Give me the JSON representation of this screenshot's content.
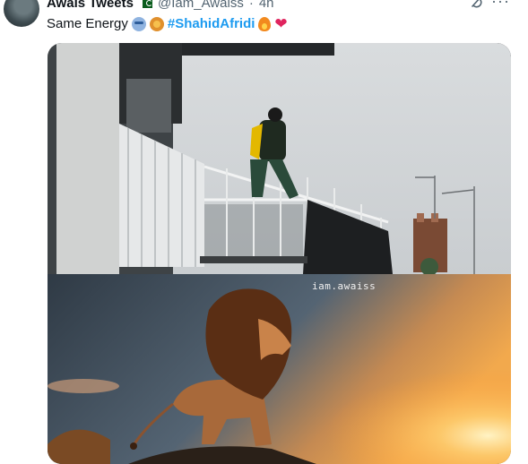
{
  "author": {
    "name": "Awais Tweets",
    "handle": "@Iam_Awaiss",
    "separator": "·",
    "time": "4h",
    "avatar_icon": "profile-avatar",
    "badge_icon": "pakistan-flag-emoji"
  },
  "tweet": {
    "text": "Same Energy",
    "emojis": [
      "mask-emoji",
      "lion-emoji"
    ],
    "hashtag": "#ShahidAfridi",
    "trailing_emojis": [
      "fire-emoji",
      "red-heart-emoji"
    ]
  },
  "media": {
    "watermark": "iam.awaiss",
    "top_image": "man-on-balcony-photo",
    "bottom_image": "lion-on-rock-at-sunset-image"
  },
  "colors": {
    "hashtag": "#1d9bf0",
    "secondary_text": "#536471",
    "heart": "#e0245e"
  }
}
